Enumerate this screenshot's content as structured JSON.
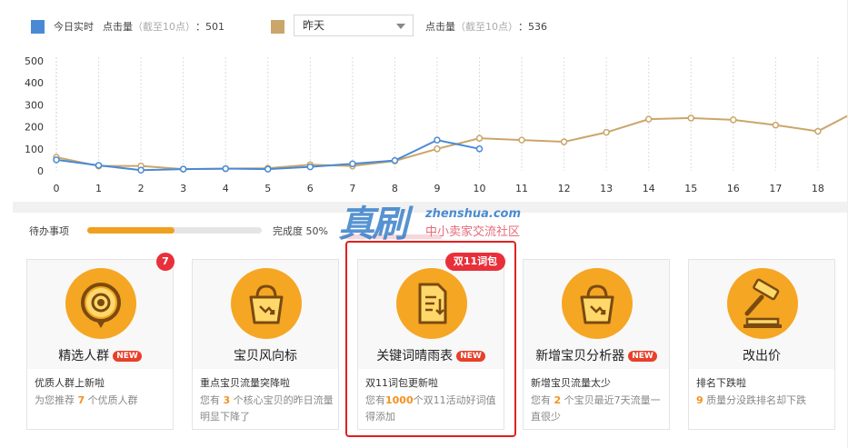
{
  "legend": {
    "today_label": "今日实时",
    "clicks_label": "点击量",
    "note": "（截至10点）",
    "colon": "：",
    "today_value": "501",
    "compare_value": "536",
    "selected_day": "昨天",
    "today_color": "#4a8ad4",
    "compare_color": "#caa66a"
  },
  "chart_data": {
    "type": "line",
    "x": [
      0,
      1,
      2,
      3,
      4,
      5,
      6,
      7,
      8,
      9,
      10,
      11,
      12,
      13,
      14,
      15,
      16,
      17,
      18,
      19
    ],
    "x_tick_labels": [
      "0",
      "1",
      "2",
      "3",
      "4",
      "5",
      "6",
      "7",
      "8",
      "9",
      "10",
      "11",
      "12",
      "13",
      "14",
      "15",
      "16",
      "17",
      "18"
    ],
    "y_ticks": [
      "0",
      "100",
      "200",
      "300",
      "400",
      "500"
    ],
    "ylim": [
      0,
      500
    ],
    "grid": "vertical dashed",
    "series": [
      {
        "key": "today",
        "color": "#4a8ad4",
        "values": [
          50,
          25,
          3,
          8,
          10,
          8,
          18,
          32,
          47,
          140,
          100
        ]
      },
      {
        "key": "yesterday",
        "color": "#caa66a",
        "values": [
          62,
          22,
          22,
          8,
          10,
          12,
          28,
          22,
          45,
          100,
          148,
          140,
          132,
          175,
          235,
          240,
          232,
          208,
          180,
          280
        ]
      }
    ]
  },
  "todo": {
    "label": "待办事项",
    "progress": 0.5,
    "progress_text": "完成度 50%"
  },
  "watermark": {
    "brand": "真刷",
    "url": "zhenshua.com",
    "slogan": "中小卖家交流社区"
  },
  "cards": [
    {
      "title": "精选人群",
      "badge": "NEW",
      "desc": "优质人群上新啦",
      "detail_pre": "为您推荐 ",
      "detail_num": "7",
      "detail_post": " 个优质人群",
      "icon": "target-crowd-icon",
      "count": "7"
    },
    {
      "title": "宝贝风向标",
      "badge": "",
      "desc": "重点宝贝流量突降啦",
      "detail_pre": "您有 ",
      "detail_num": "3",
      "detail_post": " 个核心宝贝的昨日流量明显下降了",
      "icon": "shopping-bag-trend-icon"
    },
    {
      "title": "关键词晴雨表",
      "badge": "NEW",
      "desc": "双11词包更新啦",
      "detail_pre": "您有",
      "detail_num": "1000",
      "detail_post": "个双11活动好词值得添加",
      "icon": "keyword-document-icon",
      "promo": "双11词包"
    },
    {
      "title": "新增宝贝分析器",
      "badge": "NEW",
      "desc": "新增宝贝流量太少",
      "detail_pre": "您有 ",
      "detail_num": "2",
      "detail_post": " 个宝贝最近7天流量一直很少",
      "icon": "shopping-bag-analysis-icon"
    },
    {
      "title": "改出价",
      "badge": "",
      "desc": "排名下跌啦",
      "detail_pre": "",
      "detail_num": "9",
      "detail_post": " 质量分没跌排名却下跌",
      "icon": "auction-hammer-icon"
    }
  ]
}
